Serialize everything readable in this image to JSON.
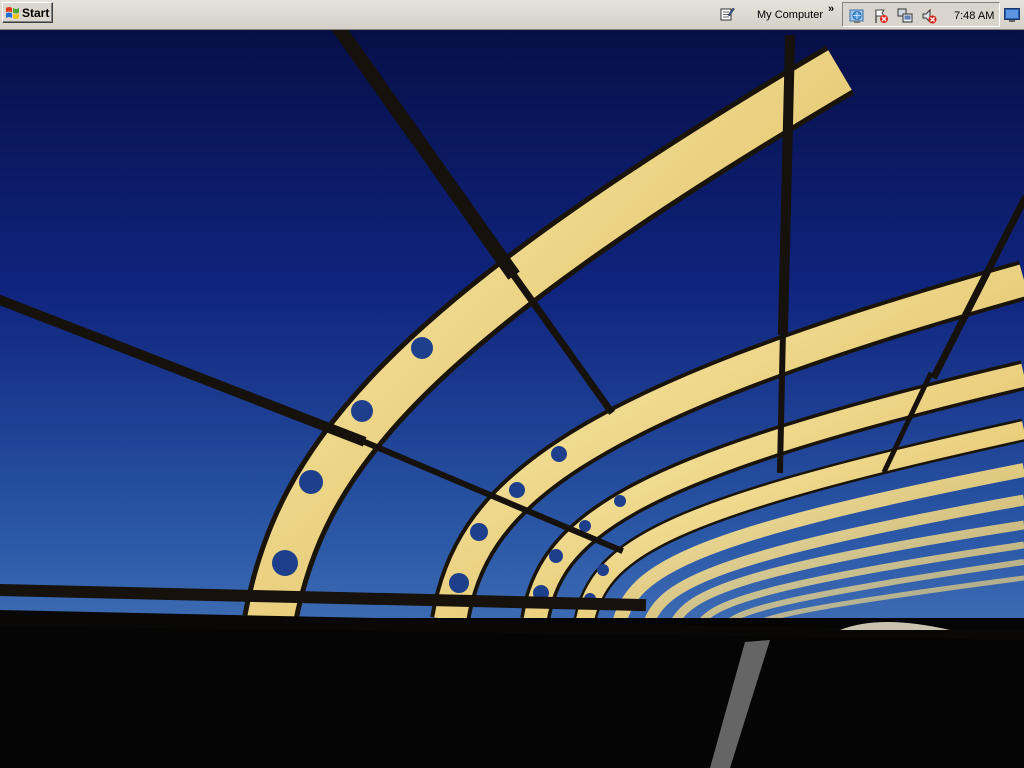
{
  "taskbar": {
    "start_label": "Start",
    "quick_launch_icon": "notepad-icon",
    "folder_label": "My Computer",
    "overflow_chevron": "»"
  },
  "tray": {
    "icons": [
      "network-globe-icon",
      "security-flag-icon",
      "network-connection-icon",
      "volume-muted-icon"
    ],
    "clock": "7:48 AM"
  },
  "desktop": {
    "wallpaper": "bridge-tunnel-sunset",
    "show_desktop_icon": "show-desktop-icon"
  },
  "colors": {
    "taskbar": "#d4d0c8",
    "sky_top": "#0b1658",
    "sky_bottom": "#3668b3",
    "arch": "#e9d48f"
  }
}
